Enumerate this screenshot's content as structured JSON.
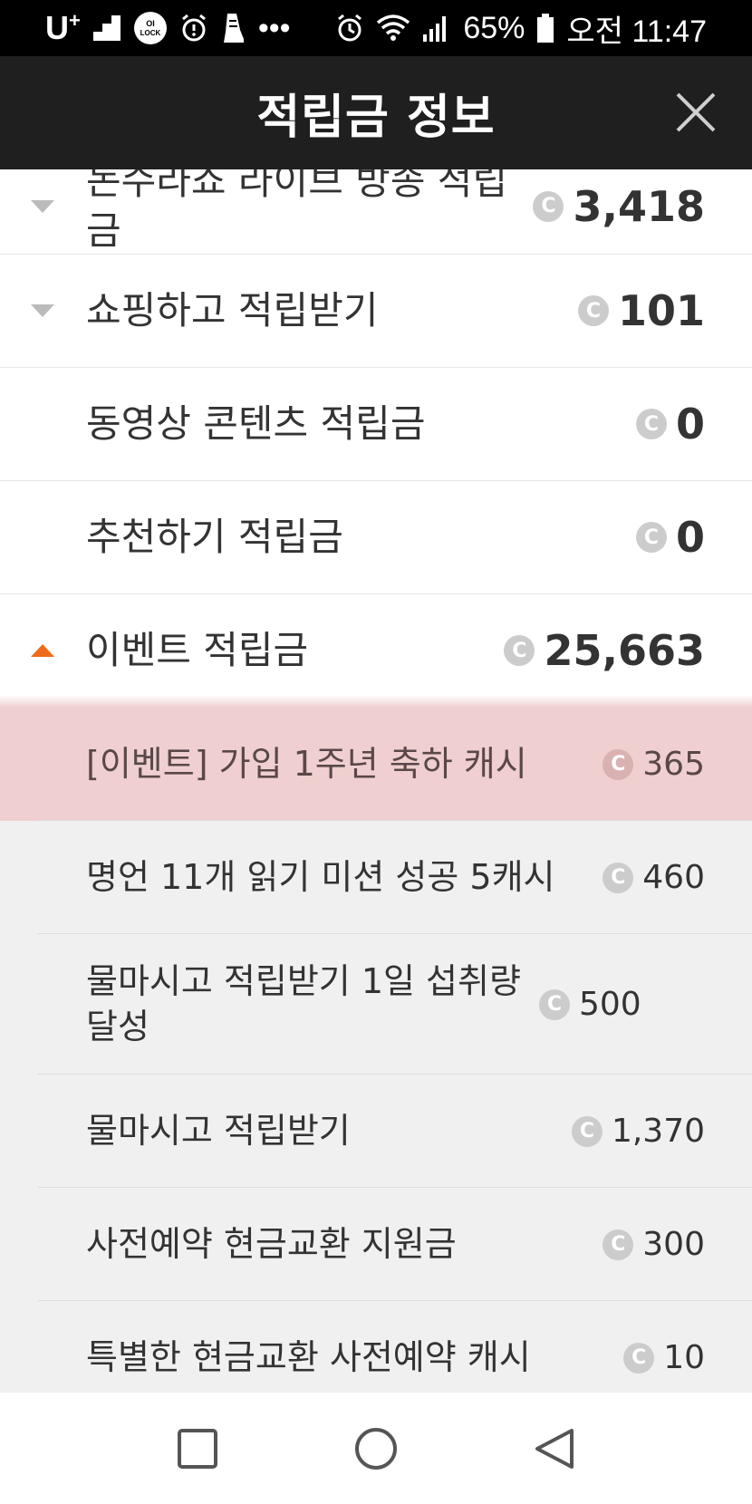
{
  "status_bar": {
    "carrier": "U",
    "carrier_sup": "+",
    "lock_badge": "OI LOCK",
    "more": "•••",
    "battery_percent": "65%",
    "time": "오전 11:47"
  },
  "header": {
    "title": "적립금 정보"
  },
  "categories_top": [
    {
      "label": "논수라쇼 라이브 방송 적립금",
      "value": "3,418",
      "arrow": "down"
    },
    {
      "label": "쇼핑하고 적립받기",
      "value": "101",
      "arrow": "down"
    },
    {
      "label": "동영상 콘텐츠 적립금",
      "value": "0",
      "arrow": "none"
    },
    {
      "label": "추천하기 적립금",
      "value": "0",
      "arrow": "none"
    },
    {
      "label": "이벤트 적립금",
      "value": "25,663",
      "arrow": "up"
    }
  ],
  "event_items": [
    {
      "label": "[이벤트] 가입 1주년 축하 캐시",
      "value": "365"
    },
    {
      "label": "명언 11개 읽기 미션 성공 5캐시",
      "value": "460"
    },
    {
      "label": "물마시고 적립받기 1일 섭취량 달성",
      "value": "500"
    },
    {
      "label": "물마시고 적립받기",
      "value": "1,370"
    },
    {
      "label": "사전예약 현금교환 지원금",
      "value": "300"
    },
    {
      "label": "특별한 현금교환 사전예약 캐시",
      "value": "10"
    }
  ],
  "coin_symbol": "C",
  "colors": {
    "header_bg": "#1f1f1f",
    "accent_arrow": "#f06a1c",
    "collapsed_arrow": "#bbbbbb",
    "highlight": "#efcfcf",
    "sub_bg": "#f0f0f0"
  },
  "nav": {
    "icons": [
      "recent-apps-icon",
      "home-icon",
      "back-icon"
    ]
  }
}
